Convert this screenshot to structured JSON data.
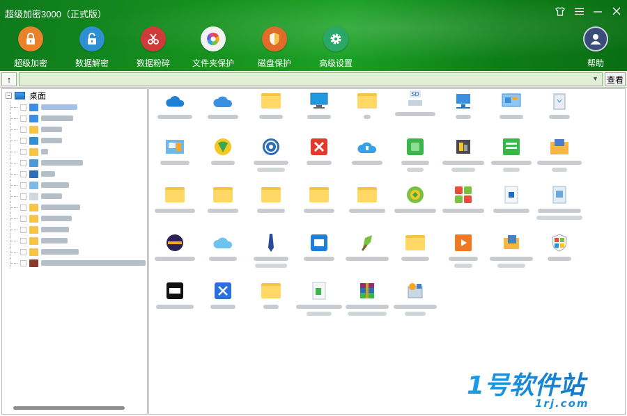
{
  "window": {
    "title": "超级加密3000（正式版）",
    "controls": [
      "shirt-icon",
      "menu-icon",
      "minimize-icon",
      "close-icon"
    ]
  },
  "toolbar": {
    "items": [
      {
        "label": "超级加密",
        "icon": "lock-icon",
        "color": "#e8822b"
      },
      {
        "label": "数据解密",
        "icon": "unlock-icon",
        "color": "#2f8fd3"
      },
      {
        "label": "数据粉碎",
        "icon": "scissors-icon",
        "color": "#cf3b3b"
      },
      {
        "label": "文件夹保护",
        "icon": "aperture-icon",
        "color": "#f2f2f2"
      },
      {
        "label": "磁盘保护",
        "icon": "shield-icon",
        "color": "#e06b2a"
      },
      {
        "label": "高级设置",
        "icon": "gear-icon",
        "color": "#2aa86a"
      },
      {
        "label": "帮助",
        "icon": "user-icon",
        "color": "#3b4e7a"
      }
    ]
  },
  "pathbar": {
    "up_label": "↑",
    "path_value": "",
    "view_label": "查看"
  },
  "tree": {
    "root_label": "桌面",
    "toggle": "−",
    "items_count_hint": "15"
  },
  "watermark": {
    "logo_text": "1号软件站",
    "domain": "1rj.com"
  },
  "colors": {
    "header_green": "#16921f",
    "path_bg": "#dff0d7",
    "watermark_blue": "#1c8fd8"
  }
}
